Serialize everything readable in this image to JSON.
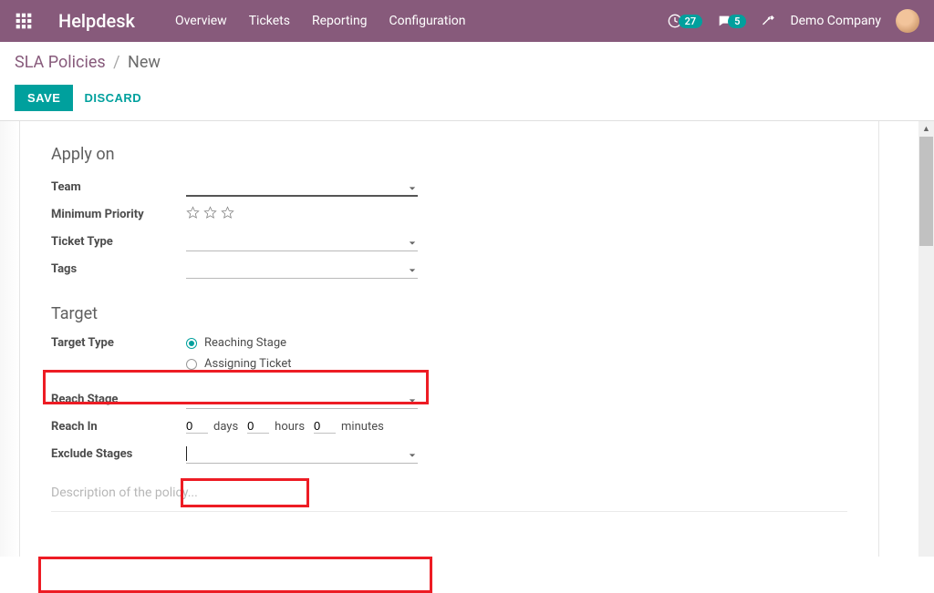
{
  "header": {
    "brand": "Helpdesk",
    "menu": [
      "Overview",
      "Tickets",
      "Reporting",
      "Configuration"
    ],
    "badge1": "27",
    "badge2": "5",
    "company": "Demo Company"
  },
  "breadcrumb": {
    "parent": "SLA Policies",
    "current": "New"
  },
  "buttons": {
    "save": "SAVE",
    "discard": "DISCARD"
  },
  "form": {
    "section_apply": "Apply on",
    "team_label": "Team",
    "min_priority_label": "Minimum Priority",
    "ticket_type_label": "Ticket Type",
    "tags_label": "Tags",
    "section_target": "Target",
    "target_type_label": "Target Type",
    "radio_reaching": "Reaching Stage",
    "radio_assigning": "Assigning Ticket",
    "reach_stage_label": "Reach Stage",
    "reach_in_label": "Reach In",
    "reach_in": {
      "days_val": "0",
      "days_unit": "days",
      "hours_val": "0",
      "hours_unit": "hours",
      "minutes_val": "0",
      "minutes_unit": "minutes"
    },
    "exclude_stages_label": "Exclude Stages",
    "description_placeholder": "Description of the policy..."
  }
}
